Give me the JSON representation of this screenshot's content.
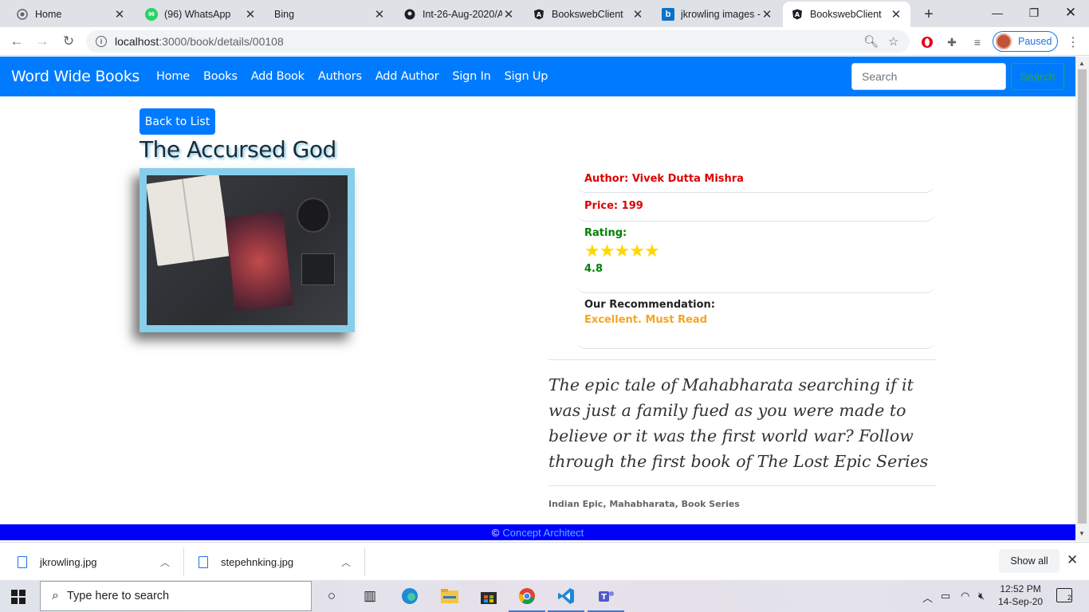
{
  "browser": {
    "tabs": [
      {
        "title": "Home",
        "icon": "globe-icon"
      },
      {
        "title": "(96) WhatsApp",
        "icon": "whatsapp-icon"
      },
      {
        "title": "Bing",
        "icon": "bing-icon"
      },
      {
        "title": "Int-26-Aug-2020/A",
        "icon": "github-icon"
      },
      {
        "title": "BookswebClient",
        "icon": "angular-icon"
      },
      {
        "title": "jkrowling images -",
        "icon": "bing-icon"
      },
      {
        "title": "BookswebClient",
        "icon": "angular-icon",
        "active": true
      }
    ],
    "whatsapp_badge": "96",
    "url_host": "localhost",
    "url_path": ":3000/book/details/00108",
    "profile_status": "Paused"
  },
  "app": {
    "brand": "Word Wide Books",
    "nav": [
      "Home",
      "Books",
      "Add Book",
      "Authors",
      "Add Author",
      "Sign In",
      "Sign Up"
    ],
    "search_placeholder": "Search",
    "search_button": "Search",
    "accent_color": "#007bff"
  },
  "book": {
    "back_label": "Back to List",
    "title": "The Accursed God",
    "author_line": "Author: Vivek Dutta Mishra",
    "price_line": "Price: 199",
    "rating_label": "Rating:",
    "rating_value": "4.8",
    "rating_number": 4.8,
    "recommendation_label": "Our Recommendation:",
    "recommendation_value": "Excellent. Must Read",
    "description": "The epic tale of Mahabharata searching if it was just a family fued as you were made to believe or it was the first world war? Follow through the first book of The Lost Epic Series",
    "tags": "Indian Epic, Mahabharata, Book Series"
  },
  "footer": {
    "copyright": "©",
    "link": "Concept Architect"
  },
  "downloads": {
    "items": [
      "jkrowling.jpg",
      "stepehnking.jpg"
    ],
    "show_all": "Show all"
  },
  "taskbar": {
    "search_placeholder": "Type here to search",
    "time": "12:52 PM",
    "date": "14-Sep-20",
    "notification_count": "2"
  }
}
